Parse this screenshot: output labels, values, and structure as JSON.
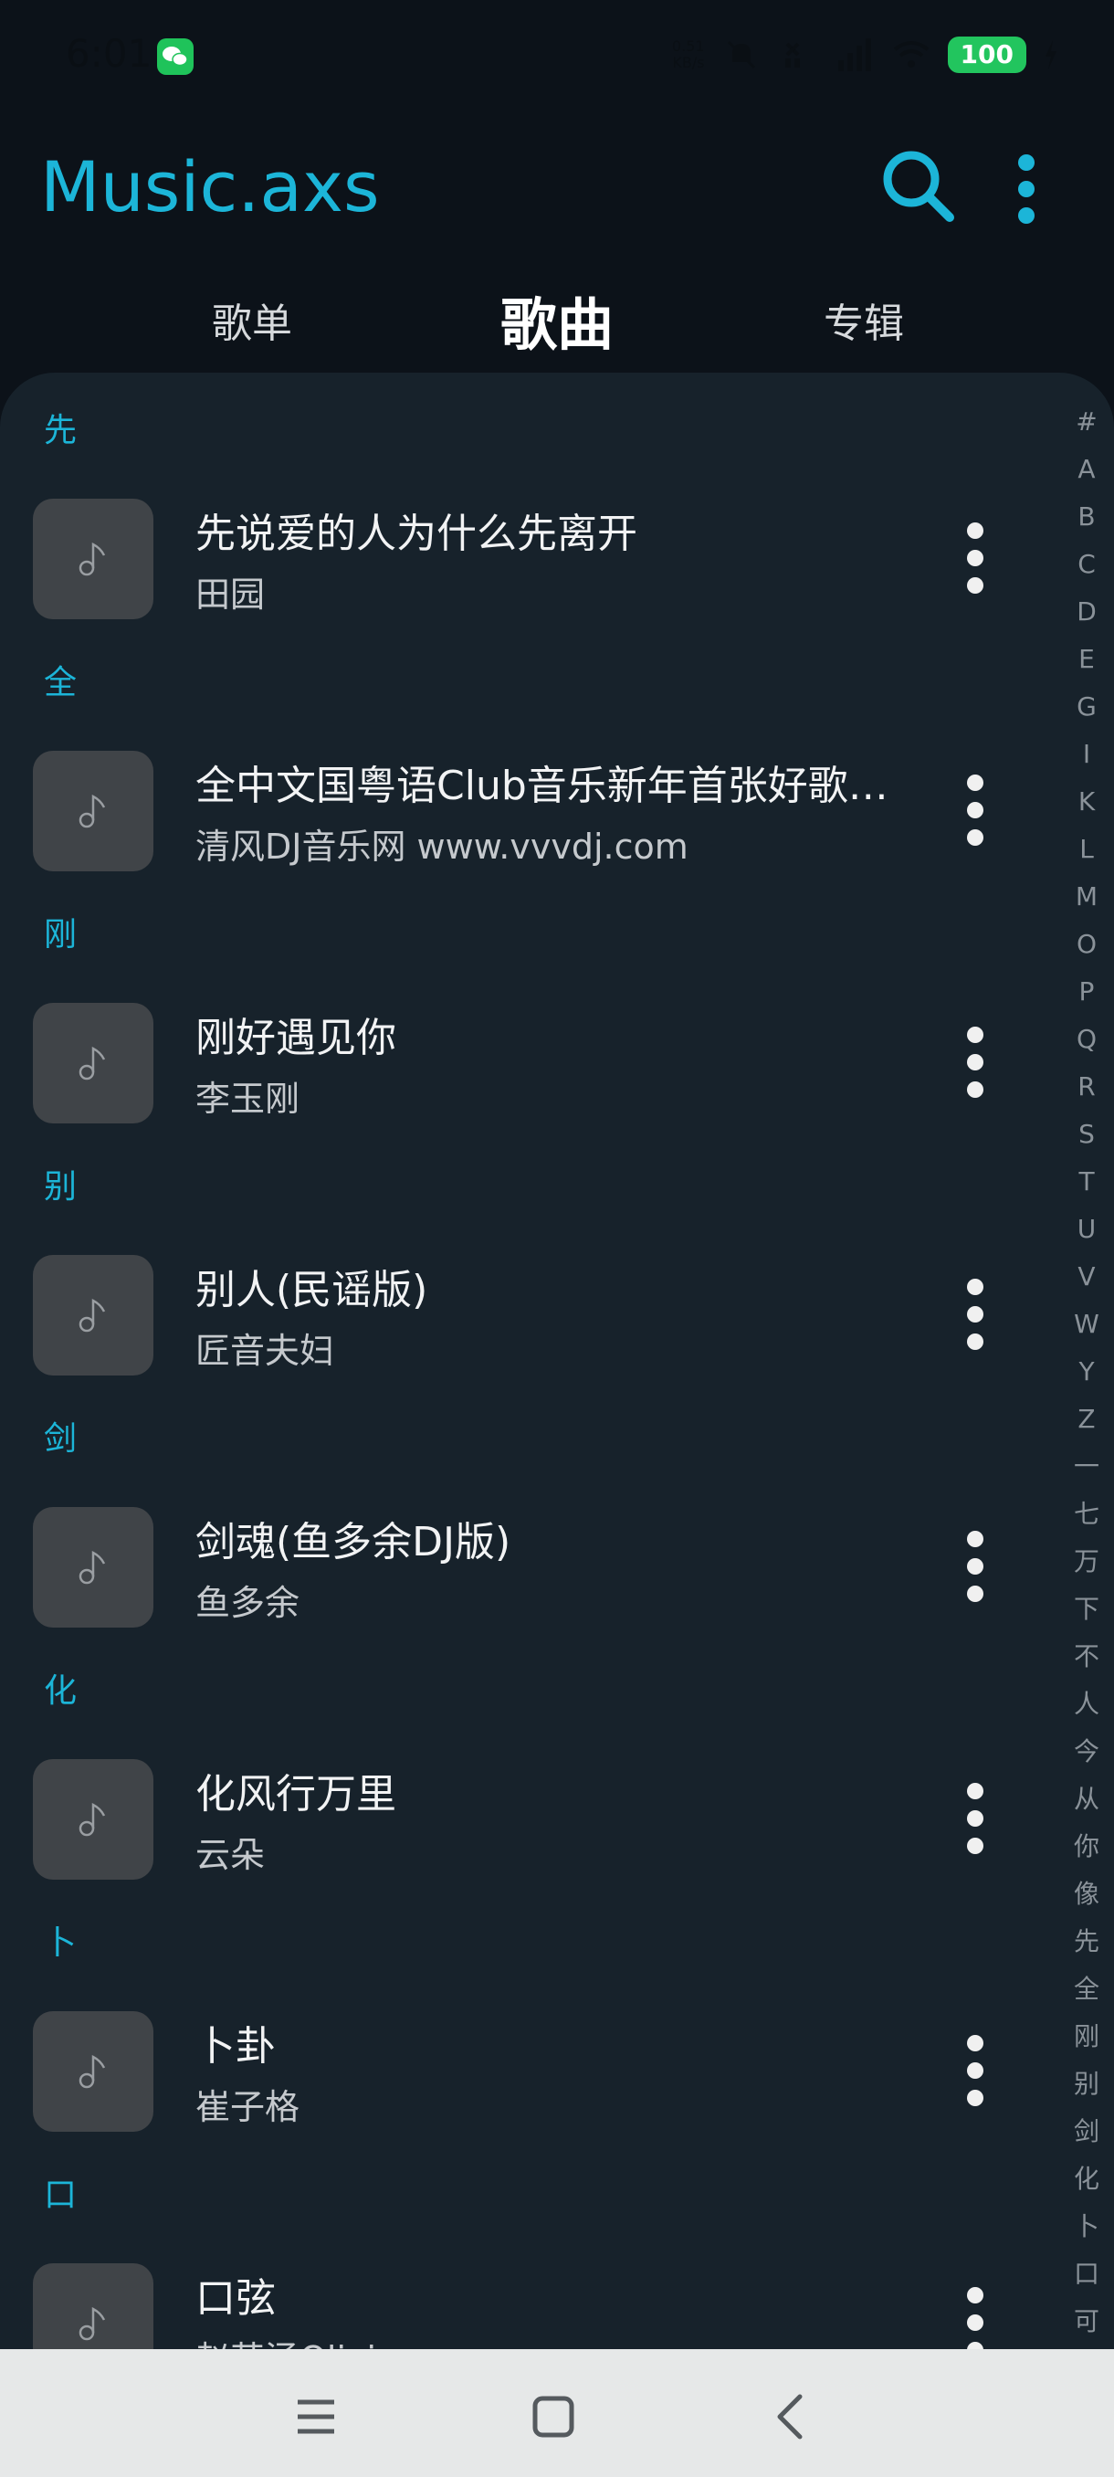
{
  "status_bar": {
    "time": "6:01",
    "net_speed_value": "0.51",
    "net_speed_unit": "KB/s",
    "battery": "100"
  },
  "app": {
    "title": "Music.axs"
  },
  "tabs": [
    {
      "label": "歌单",
      "active": false
    },
    {
      "label": "歌曲",
      "active": true
    },
    {
      "label": "专辑",
      "active": false
    }
  ],
  "sections": [
    {
      "header": "先",
      "song": {
        "title": "先说爱的人为什么先离开",
        "artist": "田园"
      }
    },
    {
      "header": "全",
      "song": {
        "title": "全中文国粤语Club音乐新年首张好歌精选",
        "artist": "清风DJ音乐网 www.vvvdj.com"
      }
    },
    {
      "header": "刚",
      "song": {
        "title": "刚好遇见你",
        "artist": "李玉刚"
      }
    },
    {
      "header": "别",
      "song": {
        "title": "别人(民谣版)",
        "artist": "匠音夫妇"
      }
    },
    {
      "header": "剑",
      "song": {
        "title": "剑魂(鱼多余DJ版)",
        "artist": "鱼多余"
      }
    },
    {
      "header": "化",
      "song": {
        "title": "化风行万里",
        "artist": "云朵"
      }
    },
    {
      "header": "卜",
      "song": {
        "title": "卜卦",
        "artist": "崔子格"
      }
    },
    {
      "header": "口",
      "song": {
        "title": "口弦",
        "artist": "赵英涵Olivia"
      }
    }
  ],
  "alphabet_index": [
    "#",
    "A",
    "B",
    "C",
    "D",
    "E",
    "G",
    "I",
    "K",
    "L",
    "M",
    "O",
    "P",
    "Q",
    "R",
    "S",
    "T",
    "U",
    "V",
    "W",
    "Y",
    "Z",
    "一",
    "七",
    "万",
    "下",
    "不",
    "人",
    "今",
    "从",
    "你",
    "像",
    "先",
    "全",
    "刚",
    "别",
    "剑",
    "化",
    "卜",
    "口",
    "可"
  ],
  "colors": {
    "accent": "#1cb5d8",
    "background": "#0c1219",
    "panel": "#17222b",
    "cover": "#404448",
    "battery": "#22c55e"
  },
  "icons": {
    "search": "search-icon",
    "more": "more-vertical-icon",
    "note": "music-note-icon",
    "menu": "menu-icon",
    "home": "home-square-icon",
    "back": "back-chevron-icon"
  }
}
